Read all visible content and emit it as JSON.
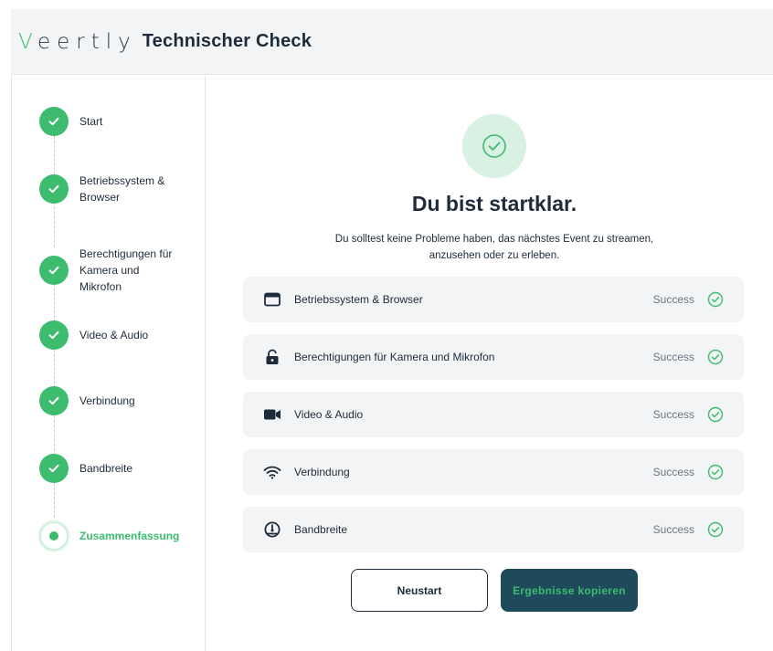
{
  "header": {
    "logo": "Veertly",
    "title": "Technischer Check"
  },
  "sidebar": {
    "steps": [
      {
        "label": "Start",
        "state": "done"
      },
      {
        "label": "Betriebssystem & Browser",
        "state": "done"
      },
      {
        "label": "Berechtigungen für Kamera und Mikrofon",
        "state": "done"
      },
      {
        "label": "Video & Audio",
        "state": "done"
      },
      {
        "label": "Verbindung",
        "state": "done"
      },
      {
        "label": "Bandbreite",
        "state": "done"
      },
      {
        "label": "Zusammenfassung",
        "state": "active"
      }
    ]
  },
  "summary": {
    "headline": "Du bist startklar.",
    "subtext": "Du solltest keine Probleme haben, das nächstes Event zu streamen, anzusehen oder zu erleben.",
    "checks": [
      {
        "icon": "browser-window-icon",
        "label": "Betriebssystem & Browser",
        "status": "Success"
      },
      {
        "icon": "unlocked-padlock-icon",
        "label": "Berechtigungen für Kamera und Mikrofon",
        "status": "Success"
      },
      {
        "icon": "video-camera-icon",
        "label": "Video & Audio",
        "status": "Success"
      },
      {
        "icon": "wifi-icon",
        "label": "Verbindung",
        "status": "Success"
      },
      {
        "icon": "speedometer-icon",
        "label": "Bandbreite",
        "status": "Success"
      }
    ]
  },
  "actions": {
    "restart_label": "Neustart",
    "copy_label": "Ergebnisse kopieren"
  },
  "colors": {
    "accent_green": "#3dbb6e",
    "dark_teal": "#1e4a5c",
    "text_dark": "#1d2b3a",
    "row_bg": "#f3f4f6"
  }
}
